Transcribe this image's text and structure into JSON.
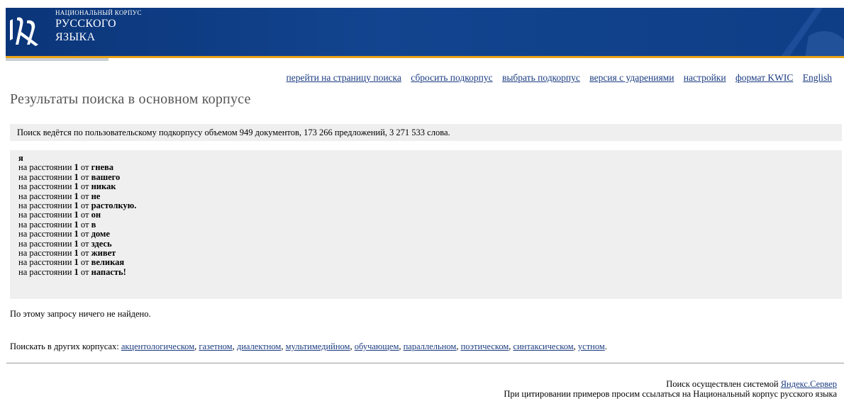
{
  "header": {
    "logo_small": "НАЦИОНАЛЬНЫЙ КОРПУС",
    "logo_line1": "РУССКОГО",
    "logo_line2": "ЯЗЫКА"
  },
  "nav": [
    {
      "label": "перейти на страницу поиска"
    },
    {
      "label": "сбросить подкорпус"
    },
    {
      "label": "выбрать подкорпус"
    },
    {
      "label": "версия с ударениями"
    },
    {
      "label": "настройки"
    },
    {
      "label": "формат KWIC"
    },
    {
      "label": "English"
    }
  ],
  "page_title": "Результаты поиска в основном корпусе",
  "subcorpus_notice": "Поиск ведётся по пользовательскому подкорпусу объемом 949 документов, 173 266 предложений, 3 271 533 слова.",
  "query": {
    "first_word": "я",
    "prefix": "на расстоянии",
    "distance": "1",
    "from": "от",
    "rows": [
      "гнева",
      "вашего",
      "никак",
      "не",
      "растолкую.",
      "он",
      "в",
      "доме",
      "здесь",
      "живет",
      "великая",
      "напасть!"
    ]
  },
  "no_results": "По этому запросу ничего не найдено.",
  "other_corpora": {
    "label": "Поискать в других корпусах:",
    "links": [
      "акцентологическом",
      "газетном",
      "диалектном",
      "мультимедийном",
      "обучающем",
      "параллельном",
      "поэтическом",
      "синтаксическом",
      "устном"
    ]
  },
  "footer": {
    "search_by": "Поиск осуществлен системой",
    "engine_link": "Яндекс.Сервер",
    "citation": "При цитировании примеров просим ссылаться на Национальный корпус русского языка"
  },
  "colors": {
    "banner": "#12448f",
    "accent_stripe": "#e9a219",
    "link": "#1a3b80"
  }
}
